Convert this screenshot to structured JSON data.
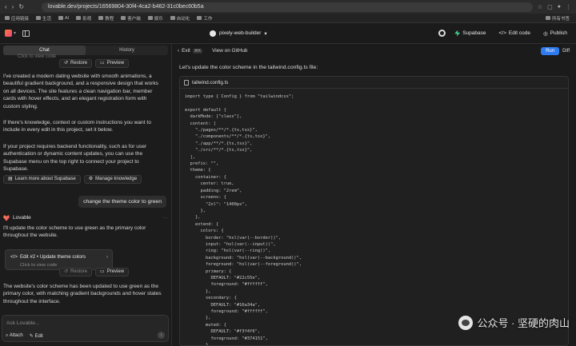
{
  "browser": {
    "url": "lovable.dev/projects/16569804-30f4-4ca2-b462-31c0bec60b5a",
    "nav_icons": [
      "back-icon",
      "forward-icon",
      "reload-icon"
    ],
    "ext_icons": [
      "star-icon",
      "extension-icon",
      "profile-icon",
      "menu-icon"
    ]
  },
  "bookmarks": {
    "items": [
      "应用链接",
      "生活",
      "AI",
      "影视",
      "教程",
      "客户端",
      "娱乐",
      "自动化",
      "工作"
    ],
    "right": "所有书签"
  },
  "header": {
    "project_name": "pixely-web-builder",
    "supabase_label": "Supabase",
    "edit_code_label": "Edit code",
    "publish_label": "Publish"
  },
  "left": {
    "tabs": [
      {
        "label": "Chat"
      },
      {
        "label": "History"
      }
    ],
    "faded_top": "Click to view code",
    "restore_label": "Restore",
    "preview_label": "Preview",
    "para1": "I've created a modern dating website with smooth animations, a beautiful gradient background, and a responsive design that works on all devices. The site features a clean navigation bar, member cards with hover effects, and an elegant registration form with custom styling.",
    "para2": "If there's knowledge, context or custom instructions you want to include in every edit in this project, set it below.",
    "para3": "If your project requires backend functionality, such as for user authentication or dynamic content updates, you can use the Supabase menu on the top right to connect your project to Supabase.",
    "learn_supabase_label": "Learn more about Supabase",
    "manage_knowledge_label": "Manage knowledge",
    "user_message": "change the theme color to green",
    "assistant_name": "Lovable",
    "assistant_intro": "I'll update the color scheme to use green as the primary color throughout the website.",
    "edit_card_title": "Edit #2 • Update theme colors",
    "edit_card_sub": "Click to view code",
    "assistant_summary": "The website's color scheme has been updated to use green as the primary color, with matching gradient backgrounds and hover states throughout the interface.",
    "input_placeholder": "Ask Lovable...",
    "attach_label": "Attach",
    "edit_label": "Edit"
  },
  "right": {
    "exit_label": "Exit",
    "exit_kbd": "⌘K",
    "github_label": "View on GitHub",
    "run_label": "Run",
    "diff_label": "Diff",
    "intro": "Let's update the color scheme in the tailwind.config.ts file:",
    "file_name": "tailwind.config.ts",
    "code_lines": [
      "import type { Config } from \"tailwindcss\";",
      "",
      "export default {",
      "  darkMode: [\"class\"],",
      "  content: [",
      "    \"./pages/**/*.{ts,tsx}\",",
      "    \"./components/**/*.{ts,tsx}\",",
      "    \"./app/**/*.{ts,tsx}\",",
      "    \"./src/**/*.{ts,tsx}\",",
      "  ],",
      "  prefix: \"\",",
      "  theme: {",
      "    container: {",
      "      center: true,",
      "      padding: \"2rem\",",
      "      screens: {",
      "        \"2xl\": \"1400px\",",
      "      },",
      "    },",
      "    extend: {",
      "      colors: {",
      "        border: \"hsl(var(--border))\",",
      "        input: \"hsl(var(--input))\",",
      "        ring: \"hsl(var(--ring))\",",
      "        background: \"hsl(var(--background))\",",
      "        foreground: \"hsl(var(--foreground))\",",
      "        primary: {",
      "          DEFAULT: \"#22c55e\",",
      "          foreground: \"#ffffff\",",
      "        },",
      "        secondary: {",
      "          DEFAULT: \"#16a34a\",",
      "          foreground: \"#ffffff\",",
      "        },",
      "        muted: {",
      "          DEFAULT: \"#f3f4f6\",",
      "          foreground: \"#374151\",",
      "        },"
    ]
  },
  "watermark": {
    "text": "公众号 · 坚硬的肉山"
  }
}
